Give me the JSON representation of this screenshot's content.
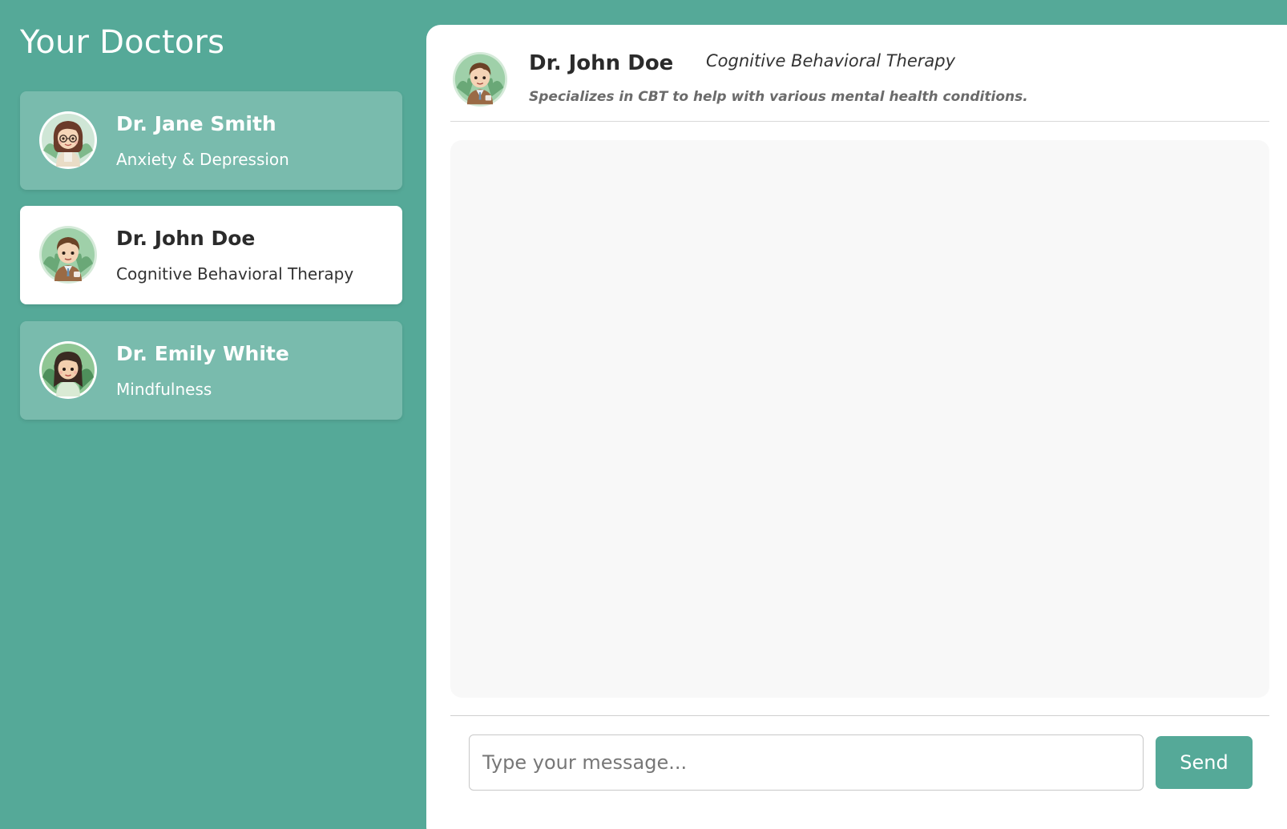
{
  "sidebar": {
    "title": "Your Doctors",
    "doctors": [
      {
        "name": "Dr. Jane Smith",
        "specialty": "Anxiety & Depression",
        "active": false
      },
      {
        "name": "Dr. John Doe",
        "specialty": "Cognitive Behavioral Therapy",
        "active": true
      },
      {
        "name": "Dr. Emily White",
        "specialty": "Mindfulness",
        "active": false
      }
    ]
  },
  "chat": {
    "doctor_name": "Dr. John Doe",
    "doctor_specialty": "Cognitive Behavioral Therapy",
    "doctor_description": "Specializes in CBT to help with various mental health conditions.",
    "input_placeholder": "Type your message...",
    "input_value": "",
    "send_label": "Send"
  },
  "colors": {
    "primary": "#55a998",
    "card_inactive": "#79bbad",
    "card_active": "#ffffff",
    "message_area": "#f8f8f8"
  },
  "icons": [
    "avatar-jane-smith",
    "avatar-john-doe",
    "avatar-emily-white"
  ]
}
